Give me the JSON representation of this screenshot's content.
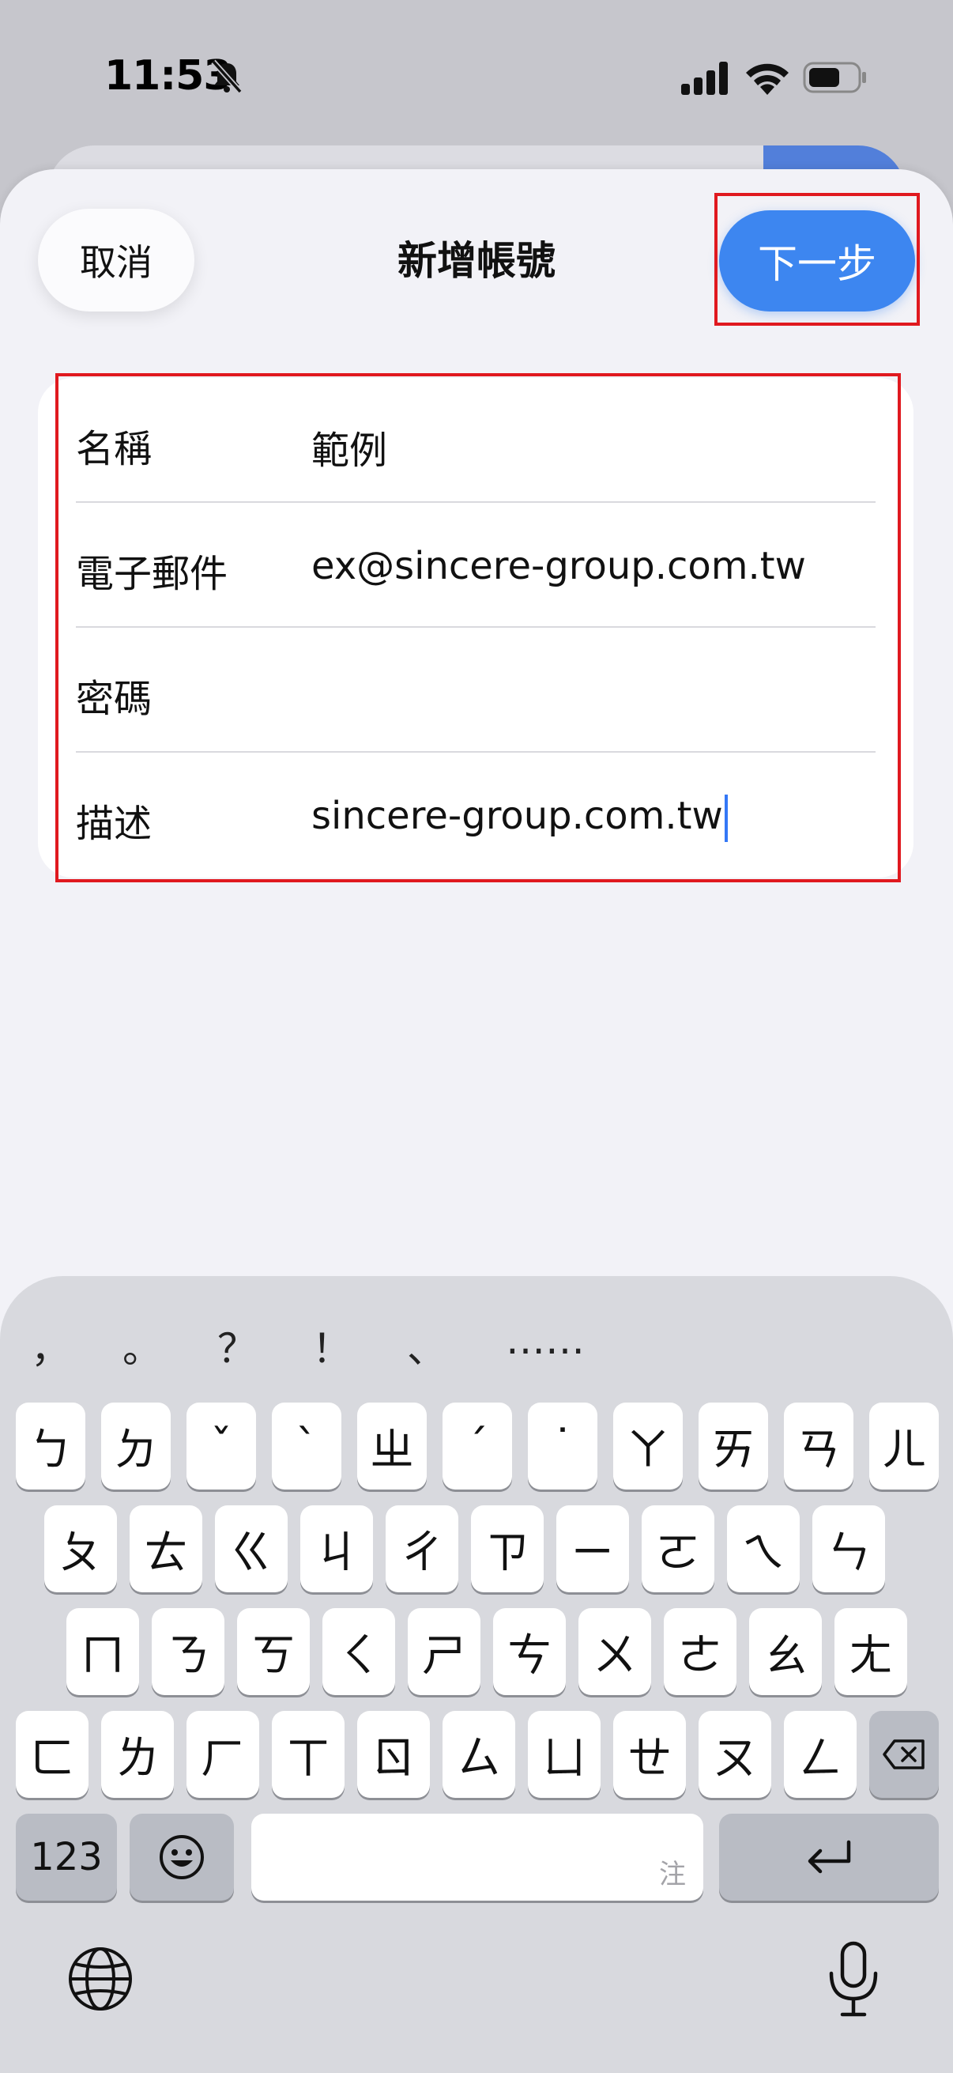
{
  "status_bar": {
    "time": "11:53"
  },
  "sheet": {
    "title": "新增帳號",
    "cancel_label": "取消",
    "next_label": "下一步"
  },
  "form": {
    "rows": [
      {
        "label": "名稱",
        "value": "範例"
      },
      {
        "label": "電子郵件",
        "value": "ex@sincere-group.com.tw"
      },
      {
        "label": "密碼",
        "value": ""
      },
      {
        "label": "描述",
        "value": "sincere-group.com.tw"
      }
    ]
  },
  "keyboard": {
    "candidates": [
      "，",
      "。",
      "？",
      "！",
      "、",
      "……"
    ],
    "row1": [
      "ㄅ",
      "ㄉ",
      "ˇ",
      "ˋ",
      "ㄓ",
      "ˊ",
      "˙",
      "ㄚ",
      "ㄞ",
      "ㄢ",
      "ㄦ"
    ],
    "row2": [
      "ㄆ",
      "ㄊ",
      "ㄍ",
      "ㄐ",
      "ㄔ",
      "ㄗ",
      "ㄧ",
      "ㄛ",
      "ㄟ",
      "ㄣ"
    ],
    "row3": [
      "ㄇ",
      "ㄋ",
      "ㄎ",
      "ㄑ",
      "ㄕ",
      "ㄘ",
      "ㄨ",
      "ㄜ",
      "ㄠ",
      "ㄤ"
    ],
    "row4": [
      "ㄈ",
      "ㄌ",
      "ㄏ",
      "ㄒ",
      "ㄖ",
      "ㄙ",
      "ㄩ",
      "ㄝ",
      "ㄡ",
      "ㄥ"
    ],
    "numbers_label": "123",
    "space_hint": "注"
  }
}
